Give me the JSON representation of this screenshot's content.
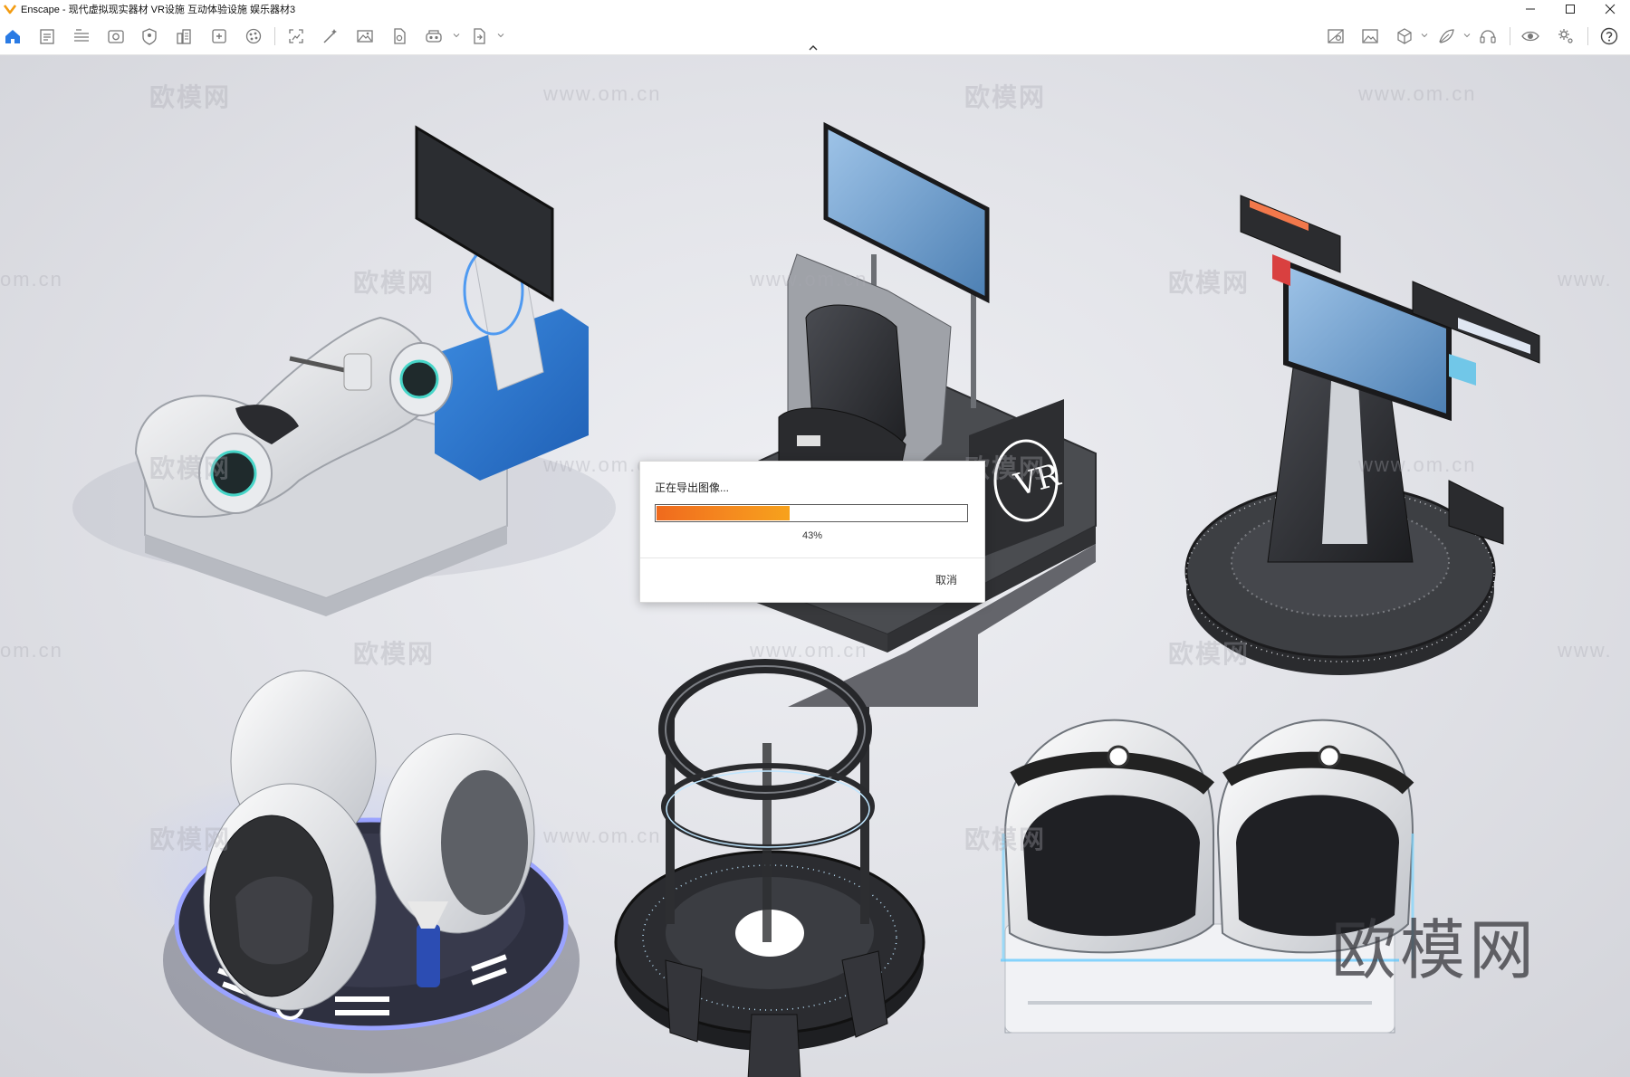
{
  "window": {
    "app_name": "Enscape",
    "title": "Enscape - 现代虚拟现实器材 VR设施 互动体验设施 娱乐器材3",
    "controls": [
      "minimize-icon",
      "maximize-icon",
      "close-icon"
    ]
  },
  "toolbar": {
    "left_icons": [
      "home-icon",
      "notes-icon",
      "bim-icon",
      "visual-settings-icon",
      "asset-library-icon",
      "site-context-icon",
      "view-management-icon",
      "material-editor-icon",
      "vr-headset-icon",
      "batch-render-icon",
      "render-image-icon",
      "panorama-icon",
      "video-editor-icon",
      "export-icon"
    ],
    "right_icons": [
      "view-settings-icon",
      "image-export-icon",
      "cube-view-icon",
      "light-view-icon",
      "headset-icon",
      "eye-icon",
      "settings-icon",
      "help-icon"
    ],
    "accent_color": "#2a7be4"
  },
  "viewport": {
    "watermark_brand": "欧模网",
    "watermark_url": "www.om.cn",
    "watermark_url_short": "om.cn",
    "watermark_url_partial": "www."
  },
  "export_dialog": {
    "title": "正在导出图像...",
    "progress_fraction": 0.43,
    "progress_label": "43%",
    "cancel_label": "取消"
  },
  "scene": {
    "seat_badge": "VR"
  }
}
